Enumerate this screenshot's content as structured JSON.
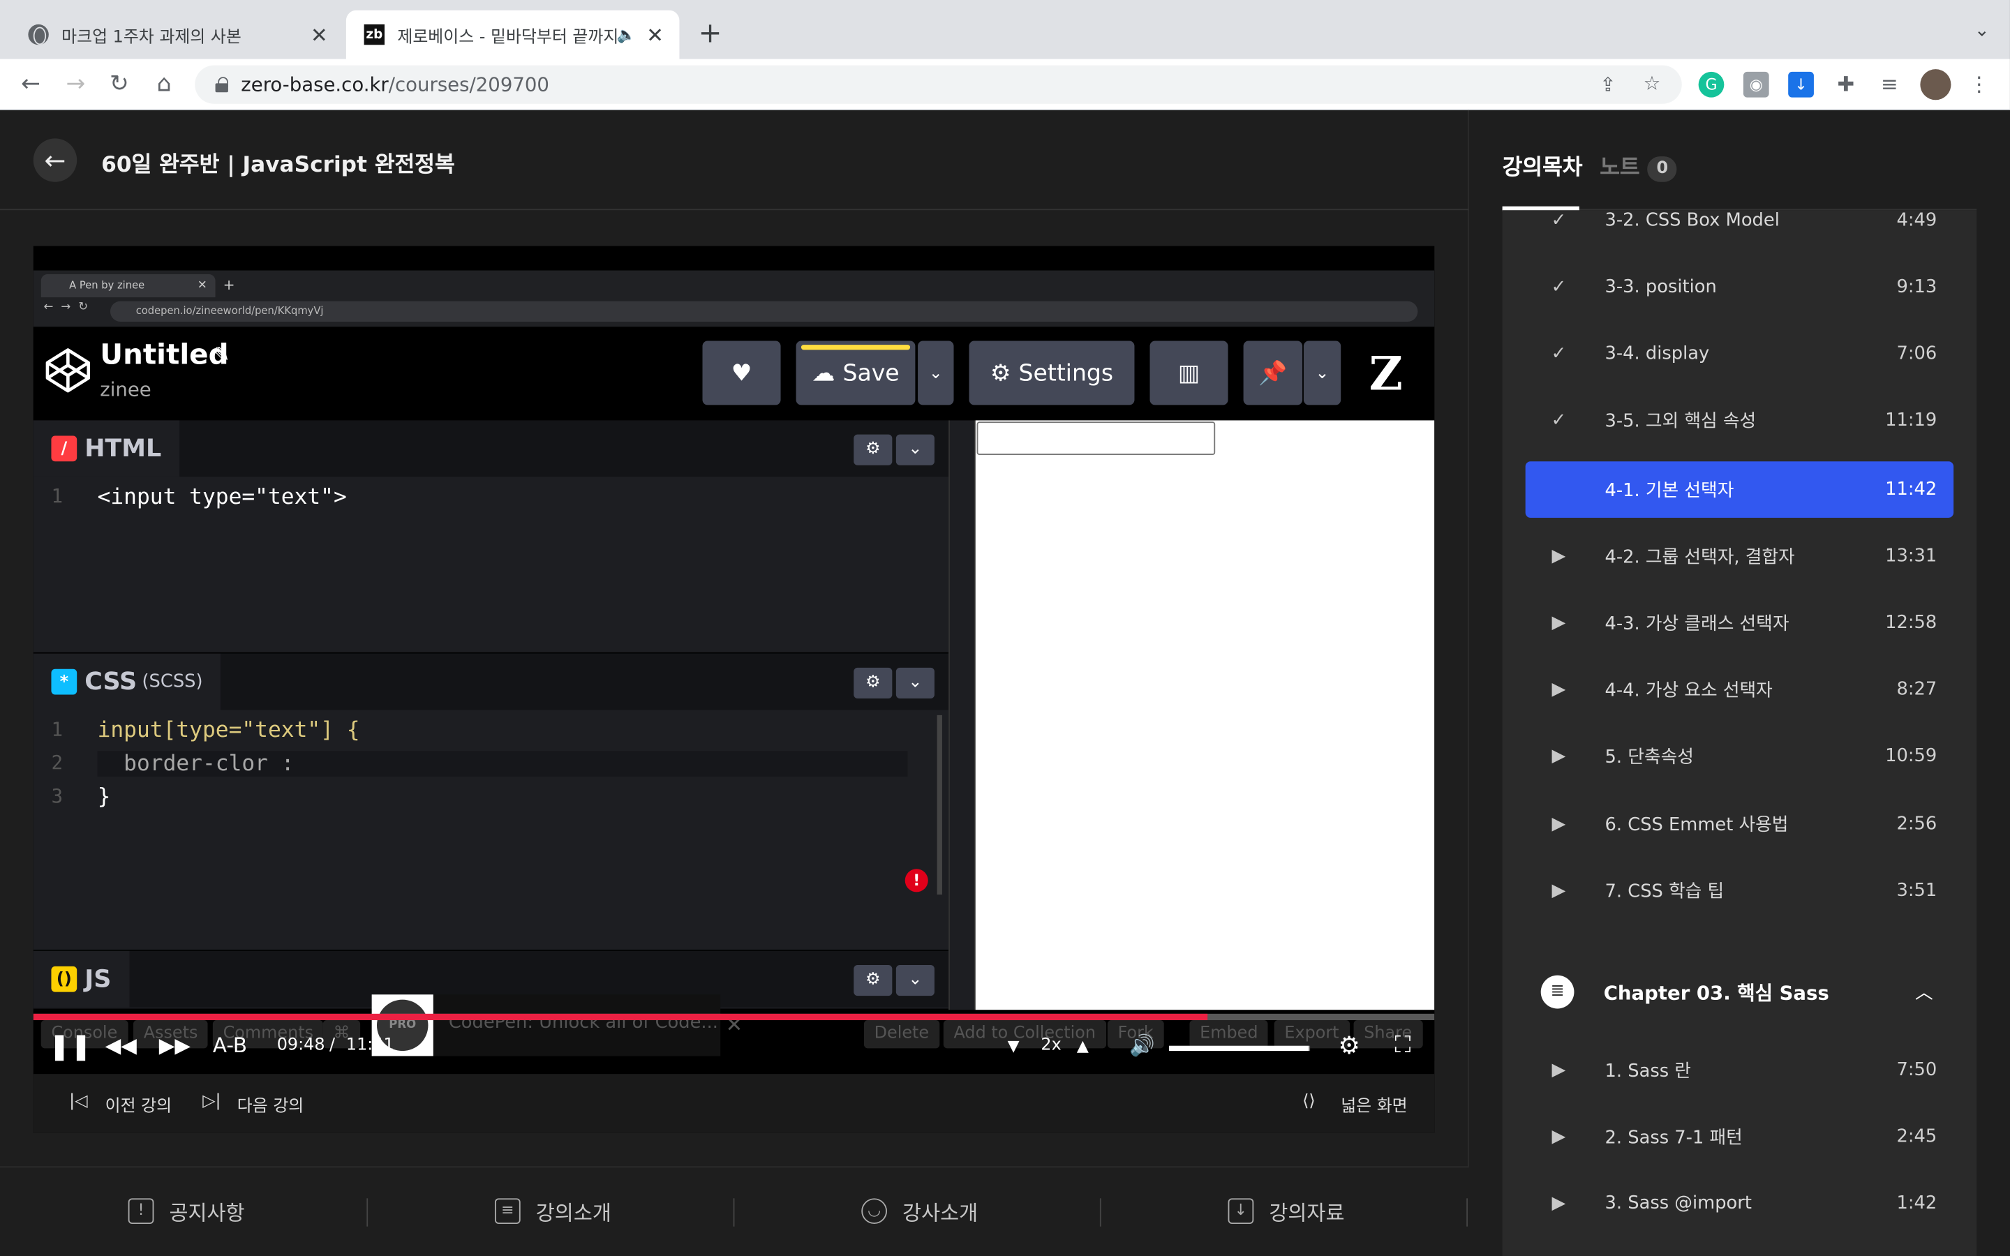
{
  "browser": {
    "tabs": [
      {
        "title": "마크업 1주차 과제의 사본",
        "active": false
      },
      {
        "title": "제로베이스 - 밑바닥부터 끝까지",
        "active": true,
        "favicon_text": "zb"
      }
    ],
    "url_host": "zero-base.co.kr",
    "url_path": "/courses/209700"
  },
  "course": {
    "title": "60일 완주반 | JavaScript 완전정복"
  },
  "video": {
    "inner_browser": {
      "tab_title": "A Pen by zinee",
      "url": "codepen.io/zineeworld/pen/KKqmyVj"
    },
    "codepen": {
      "pen_title": "Untitled",
      "user": "zinee",
      "save_label": "Save",
      "settings_label": "Settings",
      "html_label": "HTML",
      "css_label": "CSS",
      "css_sub": "(SCSS)",
      "js_label": "JS",
      "html_code": [
        "<input type=\"text\">"
      ],
      "css_code": [
        "input[type=\"text\"] {",
        "  border-clor :",
        "}"
      ],
      "footer_buttons": [
        "Console",
        "Assets",
        "Comments",
        "⌘",
        "Delete",
        "Add to Collection",
        "Fork",
        "Embed",
        "Export",
        "Share"
      ],
      "promo_text": "CodePen: Unlock all of Code...",
      "promo_badge": "PRO"
    },
    "player": {
      "current_time": "09:48",
      "duration": "11:41",
      "progress_fraction": 0.838,
      "volume_fraction": 0.99,
      "speed": "2x",
      "ab_label": "A-B",
      "prev_label": "이전 강의",
      "next_label": "다음 강의",
      "wide_label": "넓은 화면"
    }
  },
  "bottom_nav": [
    {
      "label": "공지사항",
      "icon": "notice-icon"
    },
    {
      "label": "강의소개",
      "icon": "clipboard-icon"
    },
    {
      "label": "강사소개",
      "icon": "user-icon"
    },
    {
      "label": "강의자료",
      "icon": "download-icon"
    }
  ],
  "sidebar": {
    "tab_toc": "강의목차",
    "tab_notes": "노트",
    "notes_count": "0",
    "lessons": [
      {
        "title": "3-2. CSS Box Model",
        "duration": "4:49",
        "state": "done"
      },
      {
        "title": "3-3. position",
        "duration": "9:13",
        "state": "done"
      },
      {
        "title": "3-4. display",
        "duration": "7:06",
        "state": "done"
      },
      {
        "title": "3-5. 그외 핵심 속성",
        "duration": "11:19",
        "state": "done"
      },
      {
        "title": "4-1. 기본 선택자",
        "duration": "11:42",
        "state": "current"
      },
      {
        "title": "4-2. 그룹 선택자, 결합자",
        "duration": "13:31",
        "state": "todo"
      },
      {
        "title": "4-3. 가상 클래스 선택자",
        "duration": "12:58",
        "state": "todo"
      },
      {
        "title": "4-4. 가상 요소 선택자",
        "duration": "8:27",
        "state": "todo"
      },
      {
        "title": "5. 단축속성",
        "duration": "10:59",
        "state": "todo"
      },
      {
        "title": "6. CSS Emmet 사용법",
        "duration": "2:56",
        "state": "todo"
      },
      {
        "title": "7. CSS 학습 팁",
        "duration": "3:51",
        "state": "todo"
      }
    ],
    "chapter": {
      "title": "Chapter 03. 핵심 Sass"
    },
    "chapter_lessons": [
      {
        "title": "1. Sass 란",
        "duration": "7:50",
        "state": "todo"
      },
      {
        "title": "2. Sass 7-1 패턴",
        "duration": "2:45",
        "state": "todo"
      },
      {
        "title": "3. Sass @import",
        "duration": "1:42",
        "state": "todo"
      }
    ]
  },
  "colors": {
    "accent": "#3258f0",
    "progress": "#ec2143"
  }
}
